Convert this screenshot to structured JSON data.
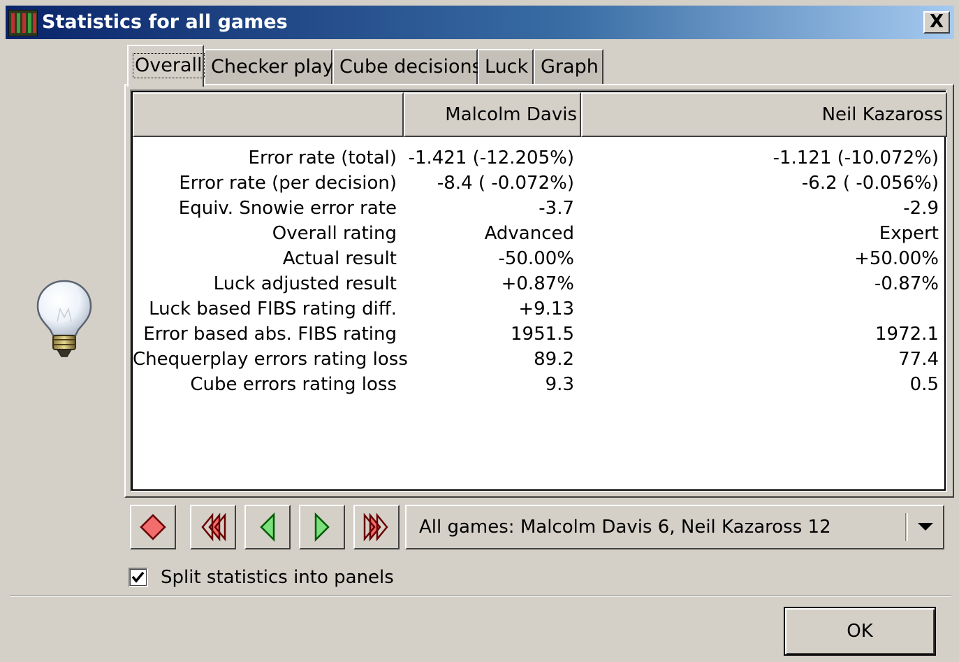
{
  "window": {
    "title": "Statistics for all games",
    "close_label": "X"
  },
  "tabs": [
    {
      "label": "Overall",
      "active": true
    },
    {
      "label": "Checker play",
      "active": false
    },
    {
      "label": "Cube decisions",
      "active": false
    },
    {
      "label": "Luck",
      "active": false
    },
    {
      "label": "Graph",
      "active": false
    }
  ],
  "table": {
    "columns": [
      "",
      "Malcolm Davis",
      "Neil Kazaross"
    ],
    "rows": [
      {
        "label": "Error rate (total)",
        "p1": "-1.421 (-12.205%)",
        "p2": "-1.121 (-10.072%)"
      },
      {
        "label": "Error rate (per decision)",
        "p1": "-8.4 ( -0.072%)",
        "p2": "-6.2 ( -0.056%)"
      },
      {
        "label": "Equiv. Snowie error rate",
        "p1": "-3.7",
        "p2": "-2.9"
      },
      {
        "label": "Overall rating",
        "p1": "Advanced",
        "p2": "Expert"
      },
      {
        "label": "Actual result",
        "p1": "-50.00%",
        "p2": "+50.00%"
      },
      {
        "label": "Luck adjusted result",
        "p1": "+0.87%",
        "p2": "-0.87%"
      },
      {
        "label": "Luck based FIBS rating diff.",
        "p1": "+9.13",
        "p2": ""
      },
      {
        "label": "Error based abs. FIBS rating",
        "p1": "1951.5",
        "p2": "1972.1"
      },
      {
        "label": "Chequerplay errors rating loss",
        "p1": "89.2",
        "p2": "77.4"
      },
      {
        "label": "Cube errors rating loss",
        "p1": "9.3",
        "p2": "0.5"
      }
    ]
  },
  "nav": {
    "buttons": [
      "stop-icon",
      "first-game-icon",
      "previous-game-icon",
      "next-game-icon",
      "last-game-icon"
    ],
    "combo_value": "All games: Malcolm Davis 6, Neil Kazaross 12"
  },
  "options": {
    "split_label": "Split statistics into panels",
    "split_checked": true
  },
  "footer": {
    "ok_label": "OK"
  },
  "colors": {
    "titlebar_start": "#0a246a",
    "titlebar_end": "#a6caf0",
    "nav_red": "#f26d6d",
    "nav_green": "#7be07b"
  }
}
